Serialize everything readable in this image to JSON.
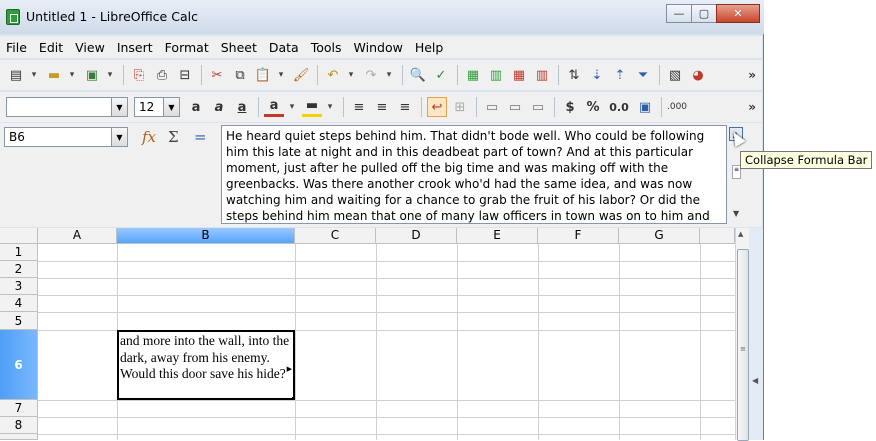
{
  "window": {
    "title": "Untitled 1 - LibreOffice Calc",
    "controls": {
      "minimize": "—",
      "maximize": "▢",
      "close": "✕"
    }
  },
  "menu": [
    {
      "label": "File"
    },
    {
      "label": "Edit"
    },
    {
      "label": "View"
    },
    {
      "label": "Insert"
    },
    {
      "label": "Format"
    },
    {
      "label": "Sheet"
    },
    {
      "label": "Data"
    },
    {
      "label": "Tools"
    },
    {
      "label": "Window"
    },
    {
      "label": "Help"
    }
  ],
  "formatting": {
    "font_name": "",
    "font_size": "12",
    "currency": "$",
    "percent": "%",
    "decimal": "0.0",
    "overflow": "»"
  },
  "formula_bar": {
    "name_box": "B6",
    "sigma": "Σ",
    "equals": "=",
    "content": "He heard quiet steps behind him. That didn't bode well. Who could be following him this late at night and in this deadbeat part of town? And at this particular moment, just after he pulled off the big time and was making off with the greenbacks. Was there another crook who'd had the same idea, and was now watching him and waiting for a chance to grab the fruit of his labor? Or did the steps behind him mean that one of many law officers in town was on to him and just waiting to pounce and snap those cuffs on his wrists? He nervously looked all around."
  },
  "tooltip": "Collapse Formula Bar",
  "sheet": {
    "columns": [
      "A",
      "B",
      "C",
      "D",
      "E",
      "F",
      "G"
    ],
    "selected_column": "B",
    "rows": [
      "1",
      "2",
      "3",
      "4",
      "5",
      "6",
      "7",
      "8"
    ],
    "selected_row": "6",
    "active_cell": {
      "ref": "B6",
      "visible_text": "and more into the wall, into the dark, away from his enemy. Would this door save his hide?"
    }
  },
  "colors": {
    "selection_header": "#57a5ff",
    "window_frame": "#d9e4f1"
  }
}
